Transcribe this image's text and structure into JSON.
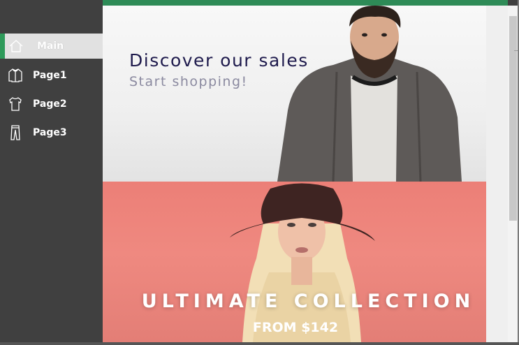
{
  "sidebar": {
    "items": [
      {
        "label": "Main",
        "icon": "home-icon",
        "active": true
      },
      {
        "label": "Page1",
        "icon": "jacket-icon",
        "active": false
      },
      {
        "label": "Page2",
        "icon": "tshirt-icon",
        "active": false
      },
      {
        "label": "Page3",
        "icon": "pants-icon",
        "active": false
      }
    ]
  },
  "banner_top": {
    "title": "Discover our sales",
    "subtitle": "Start shopping!"
  },
  "banner_bottom": {
    "title": "ULTIMATE COLLECTION",
    "subtitle": "FROM $142"
  },
  "colors": {
    "accent": "#2e8b57",
    "sidebar": "#404040",
    "banner_bottom": "#ef8980",
    "title": "#1f1b4d"
  }
}
